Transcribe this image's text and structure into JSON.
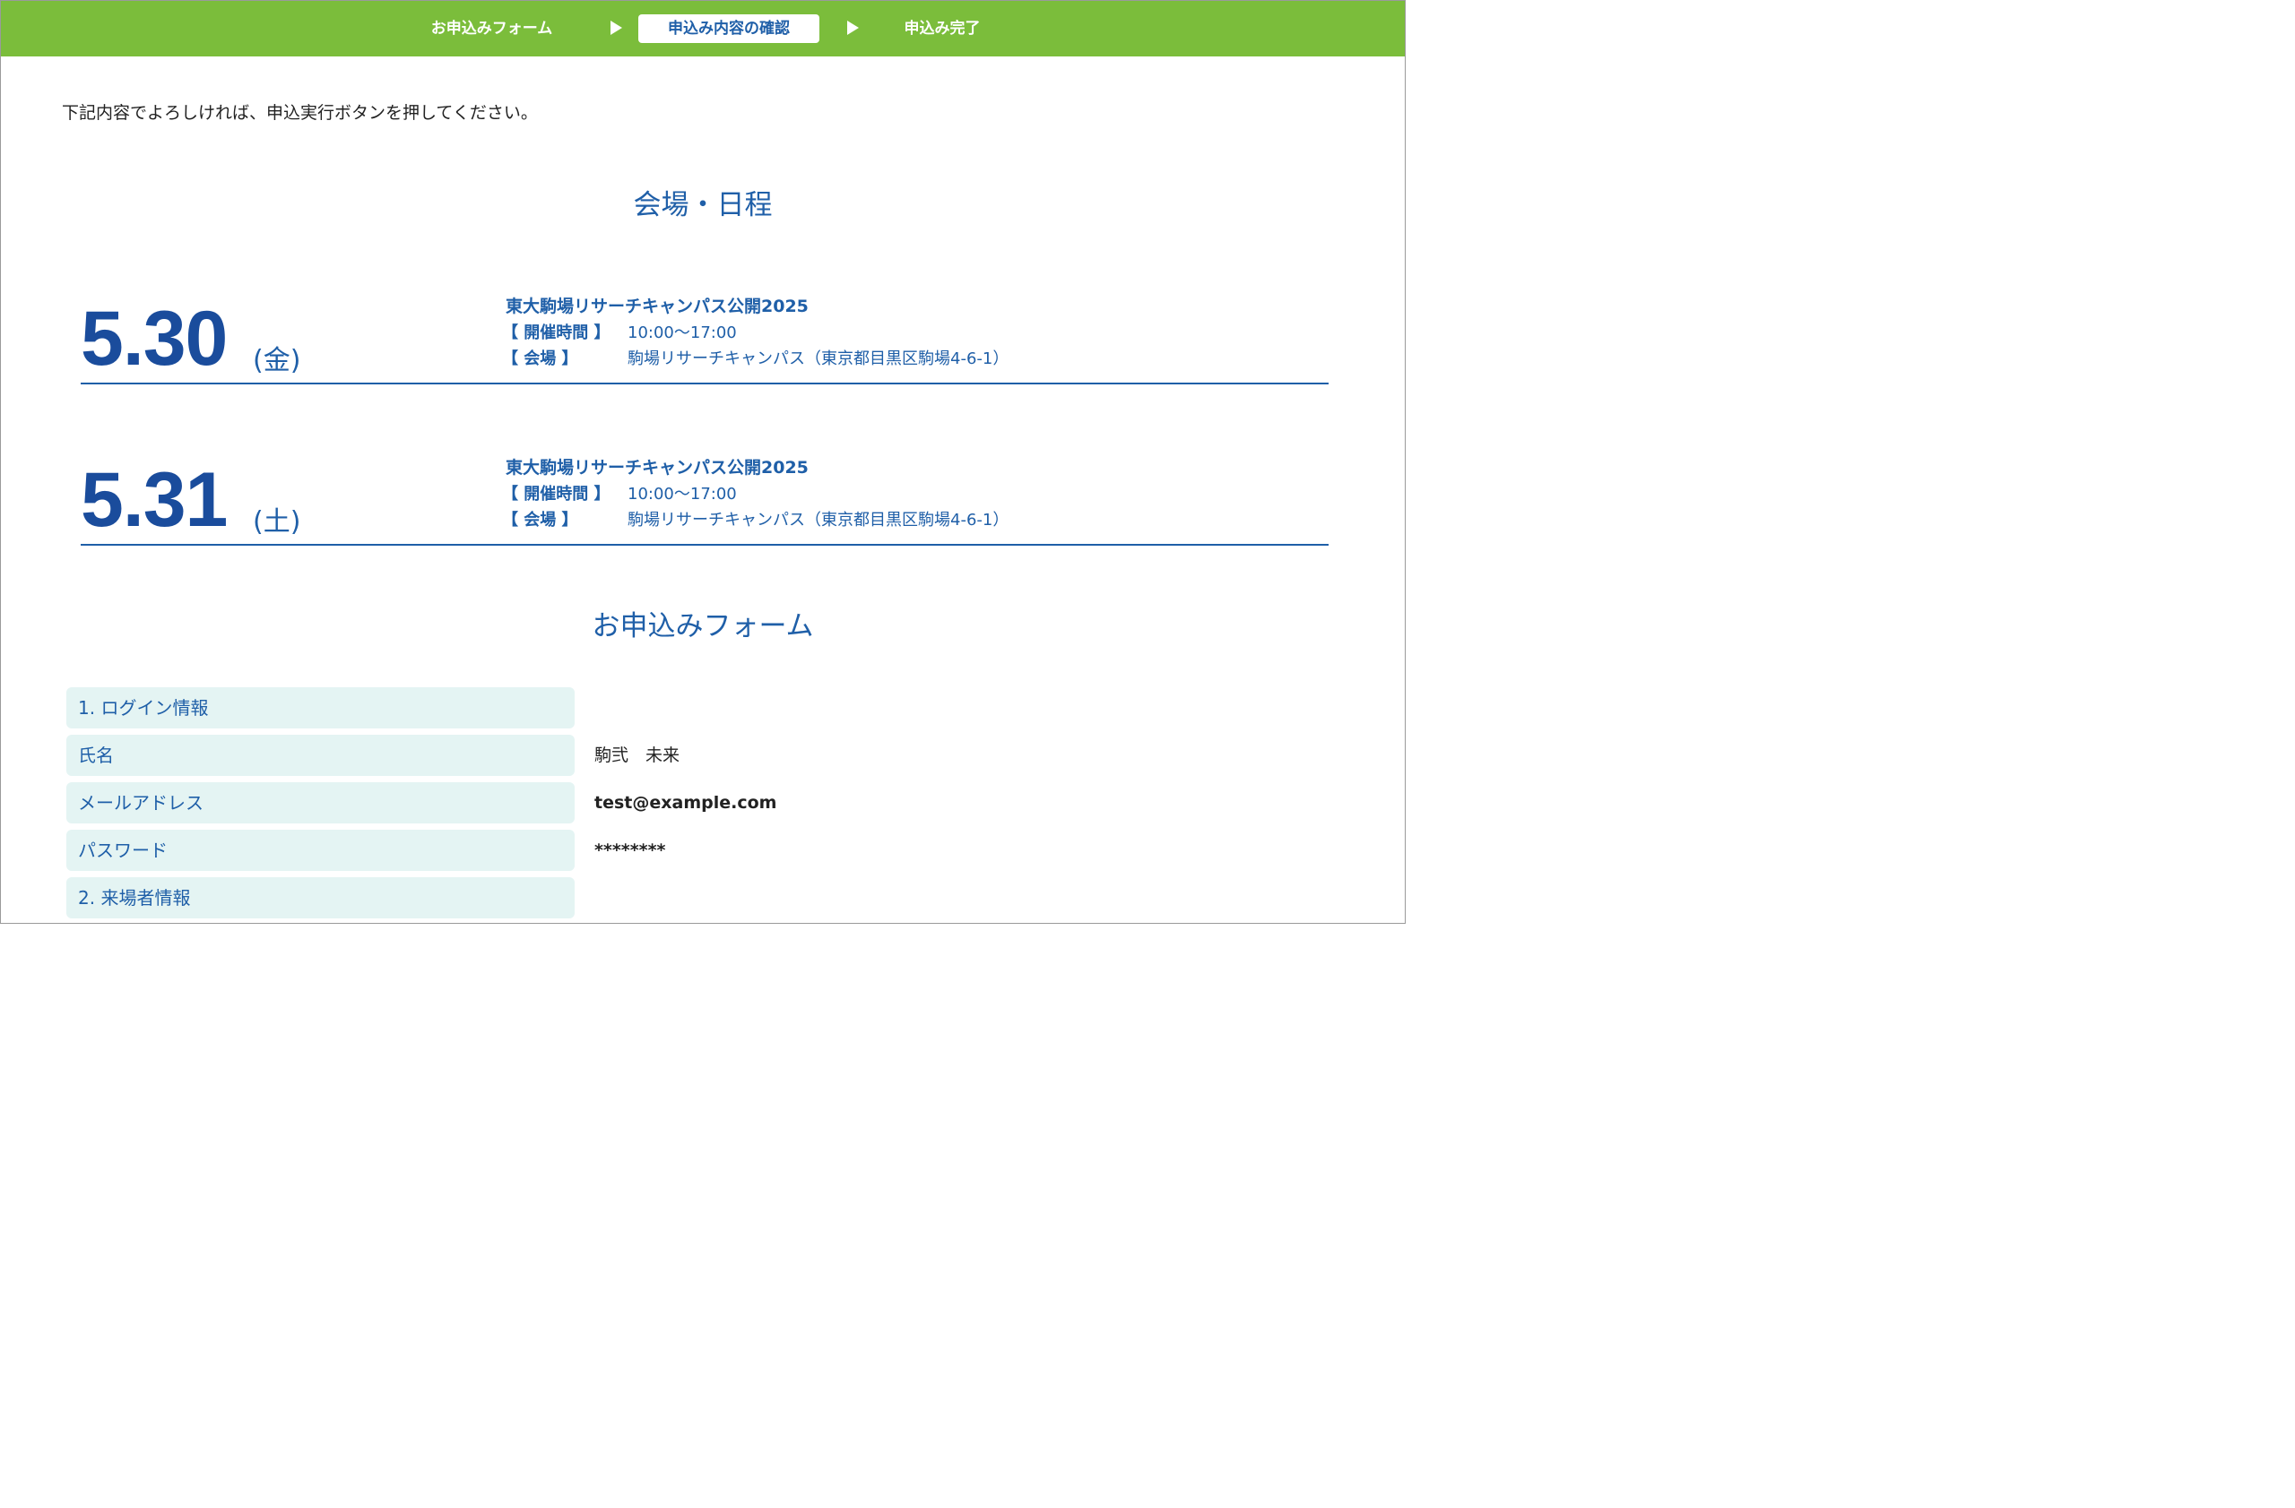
{
  "steps": {
    "step1": "お申込みフォーム",
    "step2": "申込み内容の確認",
    "step3": "申込み完了"
  },
  "intro_text": "下記内容でよろしければ、申込実行ボタンを押してください。",
  "venue_section_title": "会場・日程",
  "events": [
    {
      "date": "5.30",
      "day_of_week": "(金)",
      "title": "東大駒場リサーチキャンパス公開2025",
      "time_label": "【 開催時間 】",
      "time": "10:00〜17:00",
      "venue_label": "【 会場 】",
      "venue": "駒場リサーチキャンパス（東京都目黒区駒場4-6-1）"
    },
    {
      "date": "5.31",
      "day_of_week": "(土)",
      "title": "東大駒場リサーチキャンパス公開2025",
      "time_label": "【 開催時間 】",
      "time": "10:00〜17:00",
      "venue_label": "【 会場 】",
      "venue": "駒場リサーチキャンパス（東京都目黒区駒場4-6-1）"
    }
  ],
  "form_section_title": "お申込みフォーム",
  "form_rows": [
    {
      "label": "1. ログイン情報",
      "value": ""
    },
    {
      "label": "氏名",
      "value": "駒弐　未来"
    },
    {
      "label": "メールアドレス",
      "value": "test@example.com"
    },
    {
      "label": "パスワード",
      "value": "********"
    },
    {
      "label": "2. 来場者情報",
      "value": ""
    }
  ],
  "colors": {
    "step_bar": "#7bbd3b",
    "primary_blue": "#1f5fa8",
    "label_bg": "#e4f4f3"
  }
}
